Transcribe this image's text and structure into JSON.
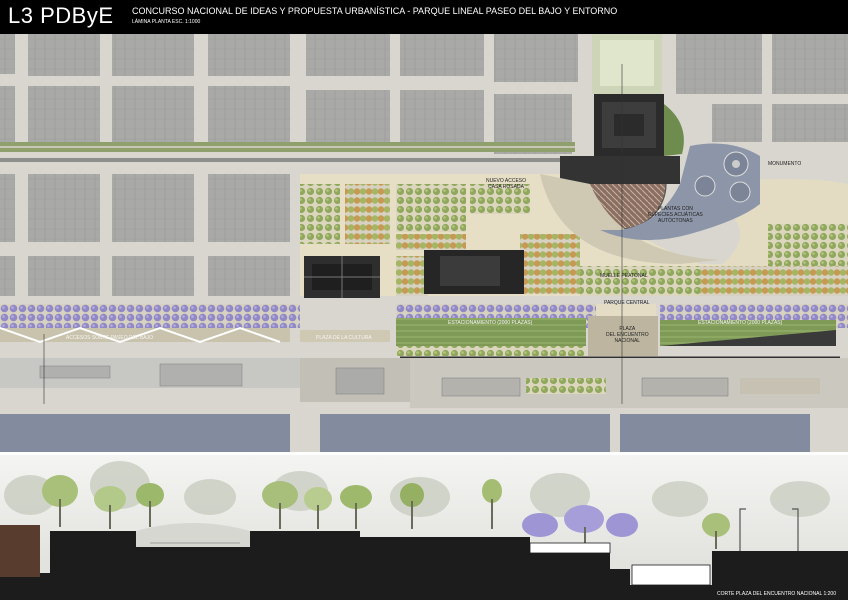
{
  "header": {
    "sheet_code": "L3  PDByE",
    "title": "CONCURSO NACIONAL DE IDEAS Y PROPUESTA URBANÍSTICA - PARQUE LINEAL PASEO DEL BAJO Y ENTORNO",
    "subtitle": "LÁMINA PLANTA ESC. 1:1000"
  },
  "plan_labels": {
    "acceso_casa_rosada": "NUEVO ACCESO\nCASA ROSADA",
    "monumento": "MONUMENTO",
    "plantas_acuaticas": "PLANTAS CON\nESPECIES ACUÁTICAS\nAUTÓCTONAS",
    "muelle_peatonal": "MUELLE PEATONAL",
    "parque_central": "PARQUE CENTRAL",
    "estacionamiento_1": "ESTACIONAMIENTO (2000 PLAZAS)",
    "estacionamiento_2": "ESTACIONAMIENTO (2000 PLAZAS)",
    "plaza_encuentro": "PLAZA\nDEL ENCUENTRO\nNACIONAL",
    "accesos_paseo": "ACCESOS SOBRE PASEO DEL BAJO",
    "plaza_cultura": "PLAZA DE LA CULTURA"
  },
  "section": {
    "caption": "CORTE PLAZA DEL ENCUENTRO NACIONAL 1:200"
  },
  "colors": {
    "header_bg": "#000000",
    "blocks": "#a7a7a5",
    "streets": "#d8d6cf",
    "water": "#8a93a6",
    "park_green": "#7e9a5c",
    "flowers": "#8d84c9",
    "plaza": "#e7dfc7",
    "ground_section": "#1c1c1c"
  }
}
